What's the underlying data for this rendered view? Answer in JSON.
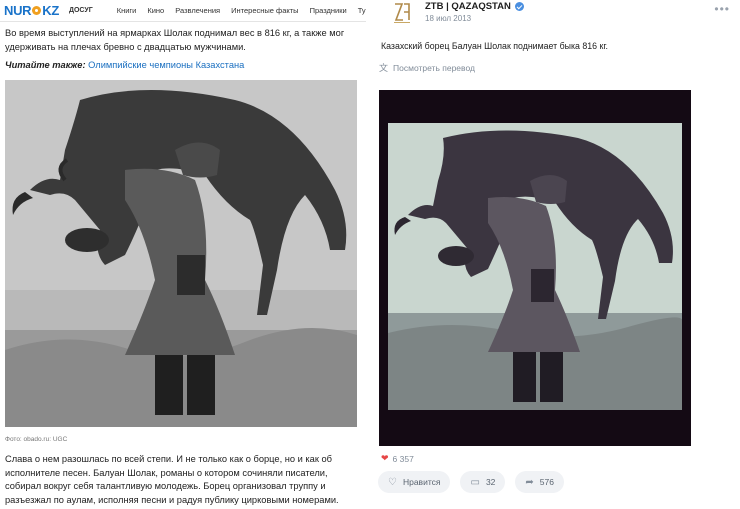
{
  "left": {
    "logo": {
      "part1": "NUR",
      "part2": "KZ"
    },
    "section_label": "ДОСУГ",
    "nav_items": [
      "Книги",
      "Кино",
      "Развлечения",
      "Интересные факты",
      "Праздники",
      "Туризм"
    ],
    "paragraph1": "Во время выступлений на ярмарках Шолак поднимал вес в 816 кг, а также мог удерживать на плечах бревно с двадцатью мужчинами.",
    "read_also_label": "Читайте также:",
    "read_also_link": "Олимпийские чемпионы Казахстана",
    "photo_caption": "Фото: obado.ru: UGC",
    "paragraph2": "Слава о нем разошлась по всей степи. И не только как о борце, но и как об исполнителе песен. Балуан Шолак, романы о котором сочиняли писатели, собирал вокруг себя талантливую молодежь. Борец организовал труппу и разъезжал по аулам, исполняя песни и радуя публику цирковыми номерами."
  },
  "right": {
    "author": "ZTB | QAZAQSTAN",
    "date": "18 июл 2013",
    "post_text": "Казахский борец Балуан Шолак поднимает быка 816 кг.",
    "translate_label": "Посмотреть перевод",
    "likes_count": "6 357",
    "like_button": "Нравится",
    "comments_count": "32",
    "shares_count": "576"
  },
  "colors": {
    "accent": "#1a73c9",
    "like": "#e64646",
    "button_bg": "#f0f2f5"
  }
}
